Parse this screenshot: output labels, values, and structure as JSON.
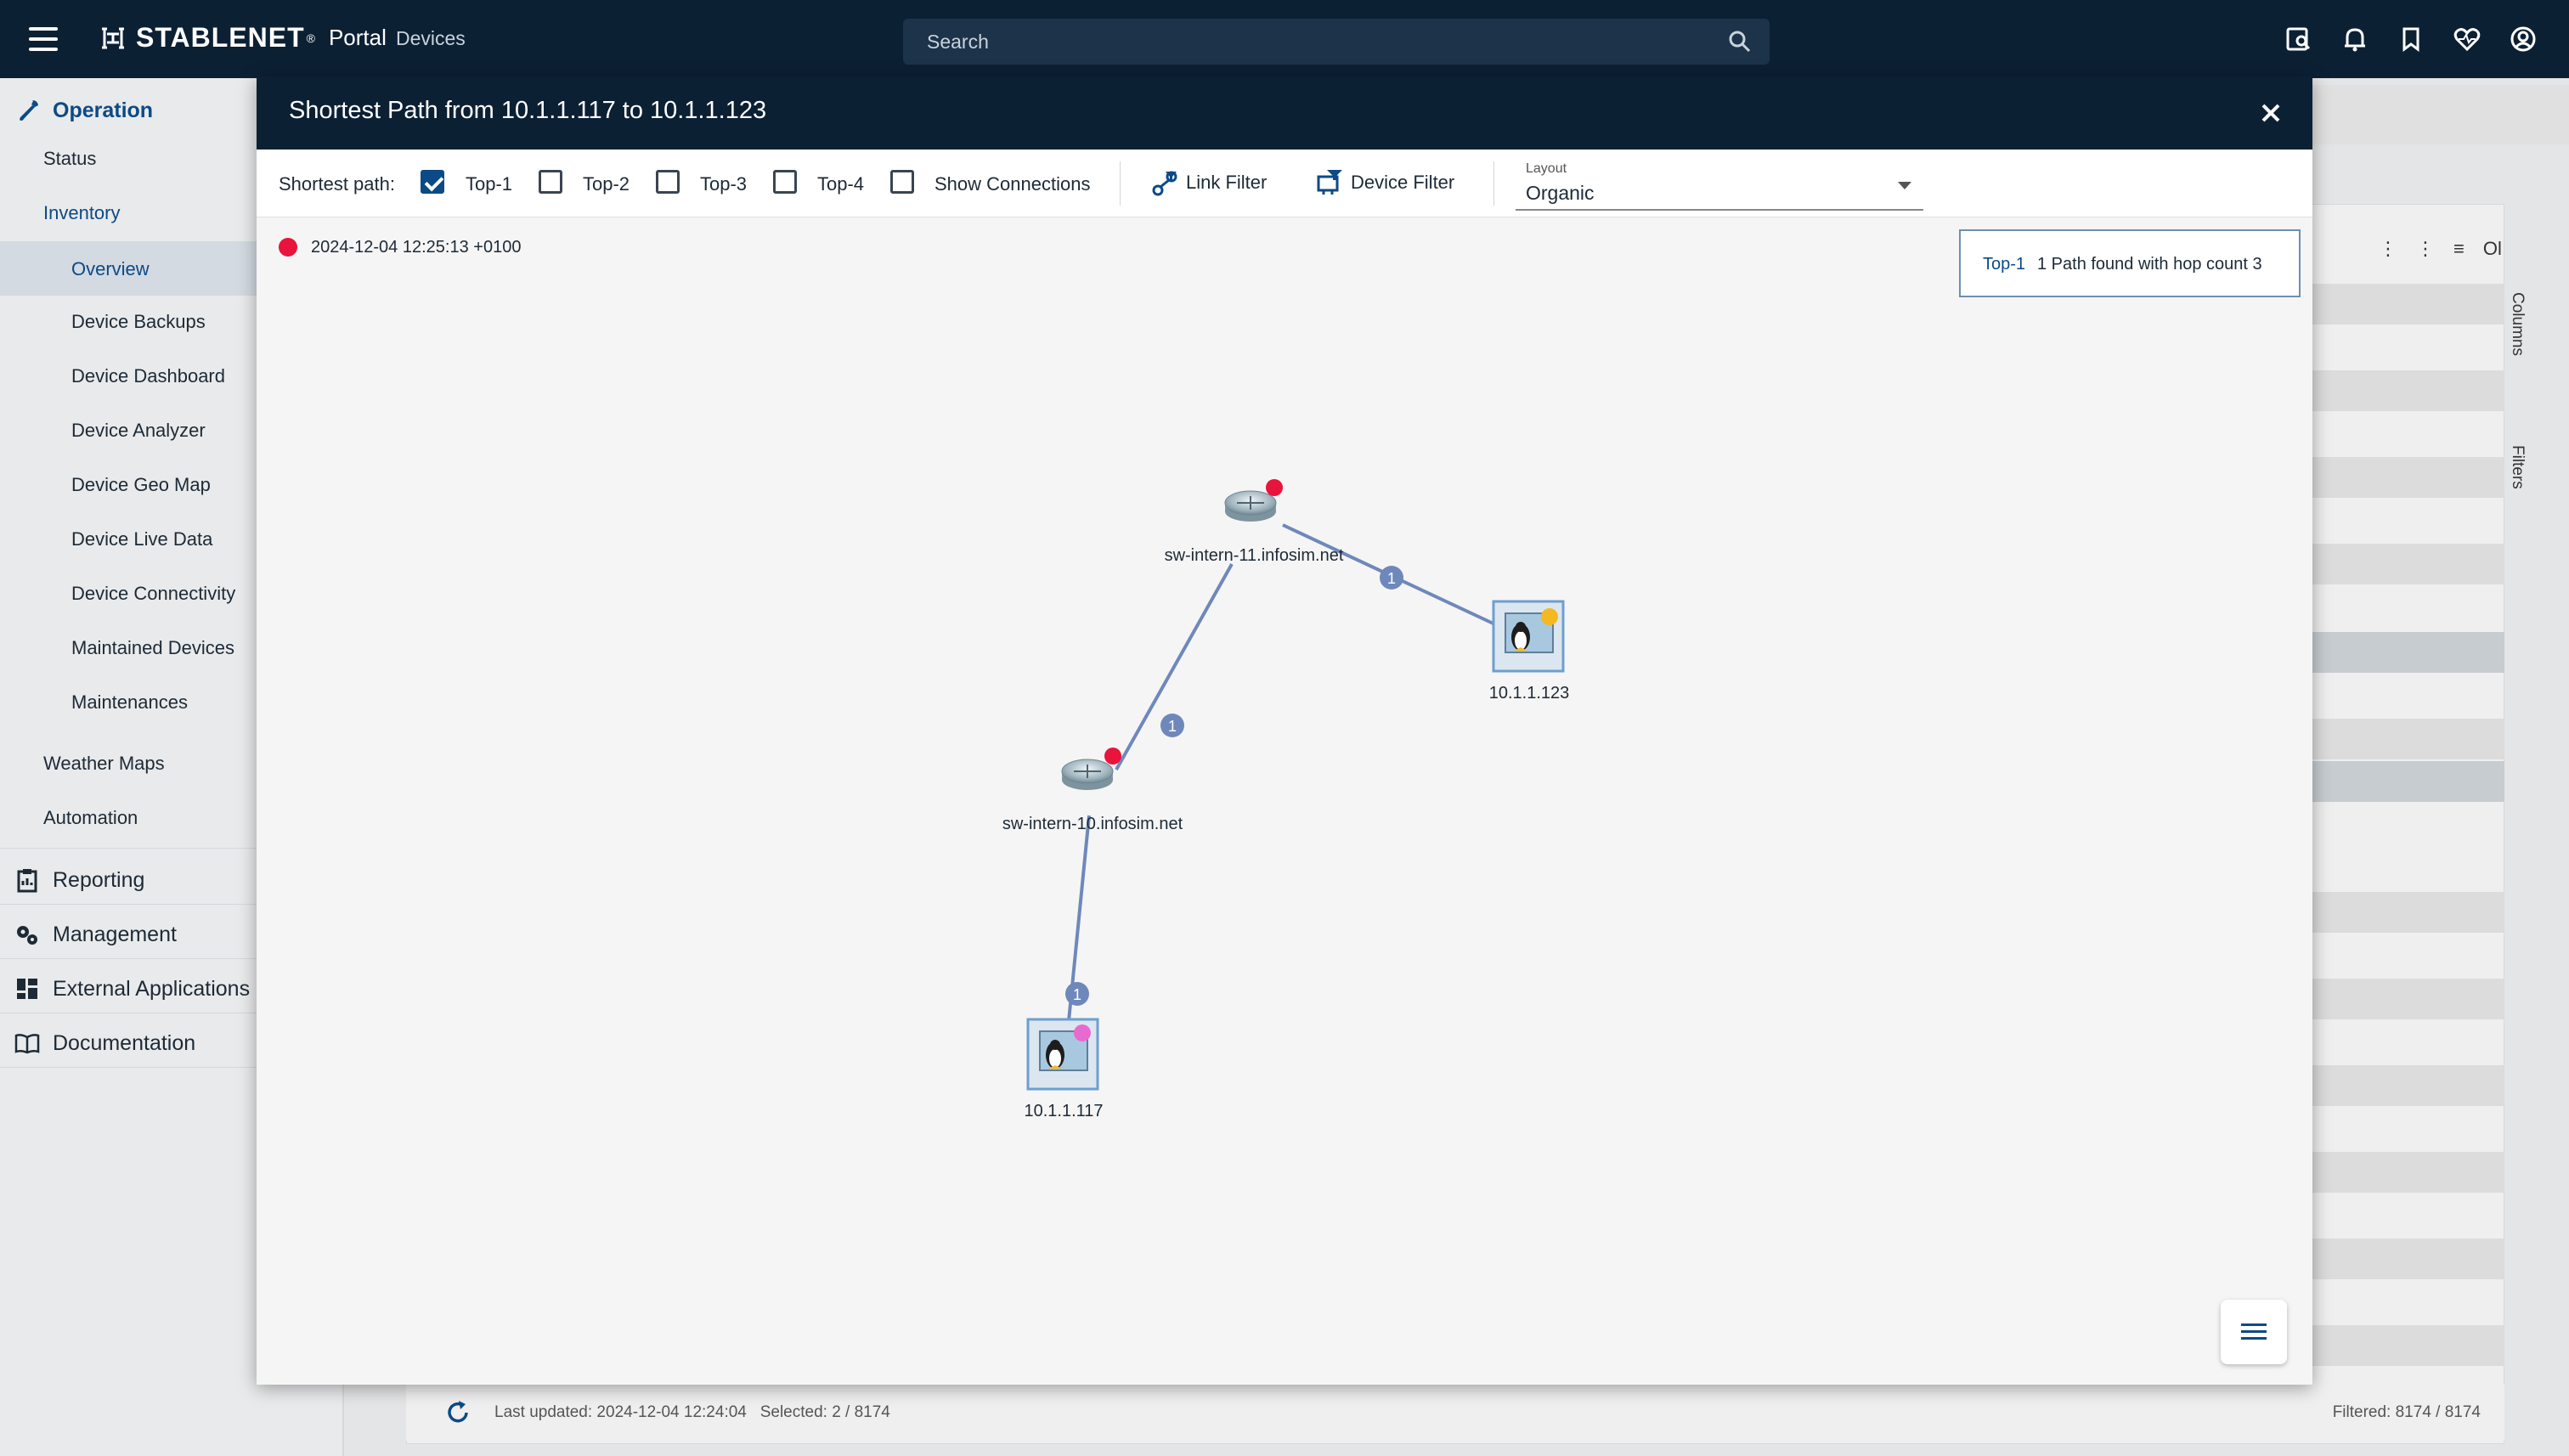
{
  "header": {
    "brand": "STABLENET",
    "brand_mark": "®",
    "portal": "Portal",
    "section": "Devices",
    "search_placeholder": "Search"
  },
  "sidebar": {
    "sections": [
      {
        "label": "Operation",
        "icon": "wrench-icon"
      },
      {
        "label": "Reporting",
        "icon": "clipboard-icon"
      },
      {
        "label": "Management",
        "icon": "gears-icon"
      },
      {
        "label": "External Applications",
        "icon": "dashboard-icon"
      },
      {
        "label": "Documentation",
        "icon": "book-icon"
      }
    ],
    "operation_items": [
      "Status",
      "Inventory",
      "Weather Maps",
      "Automation"
    ],
    "inventory_items": [
      "Overview",
      "Device Backups",
      "Device Dashboard",
      "Device Analyzer",
      "Device Geo Map",
      "Device Live Data",
      "Device Connectivity",
      "Maintained Devices",
      "Maintenances"
    ]
  },
  "background": {
    "last_updated": "Last updated: 2024-12-04 12:24:04",
    "selected": "Selected: 2 / 8174",
    "filtered": "Filtered: 8174 / 8174",
    "columns_tab": "Columns",
    "filters_tab": "Filters",
    "toolbar_text": "Ol"
  },
  "modal": {
    "title": "Shortest Path from 10.1.1.117 to 10.1.1.123",
    "toolbar": {
      "shortest_path_label": "Shortest path:",
      "options": [
        {
          "label": "Top-1",
          "checked": true
        },
        {
          "label": "Top-2",
          "checked": false
        },
        {
          "label": "Top-3",
          "checked": false
        },
        {
          "label": "Top-4",
          "checked": false
        },
        {
          "label": "Show Connections",
          "checked": false
        }
      ],
      "link_filter": "Link Filter",
      "device_filter": "Device Filter",
      "layout_label": "Layout",
      "layout_value": "Organic"
    },
    "timestamp": "2024-12-04 12:25:13 +0100",
    "path_info": {
      "key": "Top-1",
      "text": "1 Path found with hop count 3"
    },
    "nodes": [
      {
        "label": "sw-intern-11.infosim.net",
        "type": "router",
        "status_color": "#e8143c"
      },
      {
        "label": "10.1.1.123",
        "type": "linux-server",
        "status_color": "#f5b820"
      },
      {
        "label": "sw-intern-10.infosim.net",
        "type": "router",
        "status_color": "#e8143c"
      },
      {
        "label": "10.1.1.117",
        "type": "linux-server",
        "status_color": "#e86ad0"
      }
    ],
    "link_badge": "1"
  },
  "colors": {
    "header_bg": "#0c2034",
    "accent": "#0b4a86",
    "link": "#6f88bb",
    "alarm_red": "#e8143c"
  }
}
